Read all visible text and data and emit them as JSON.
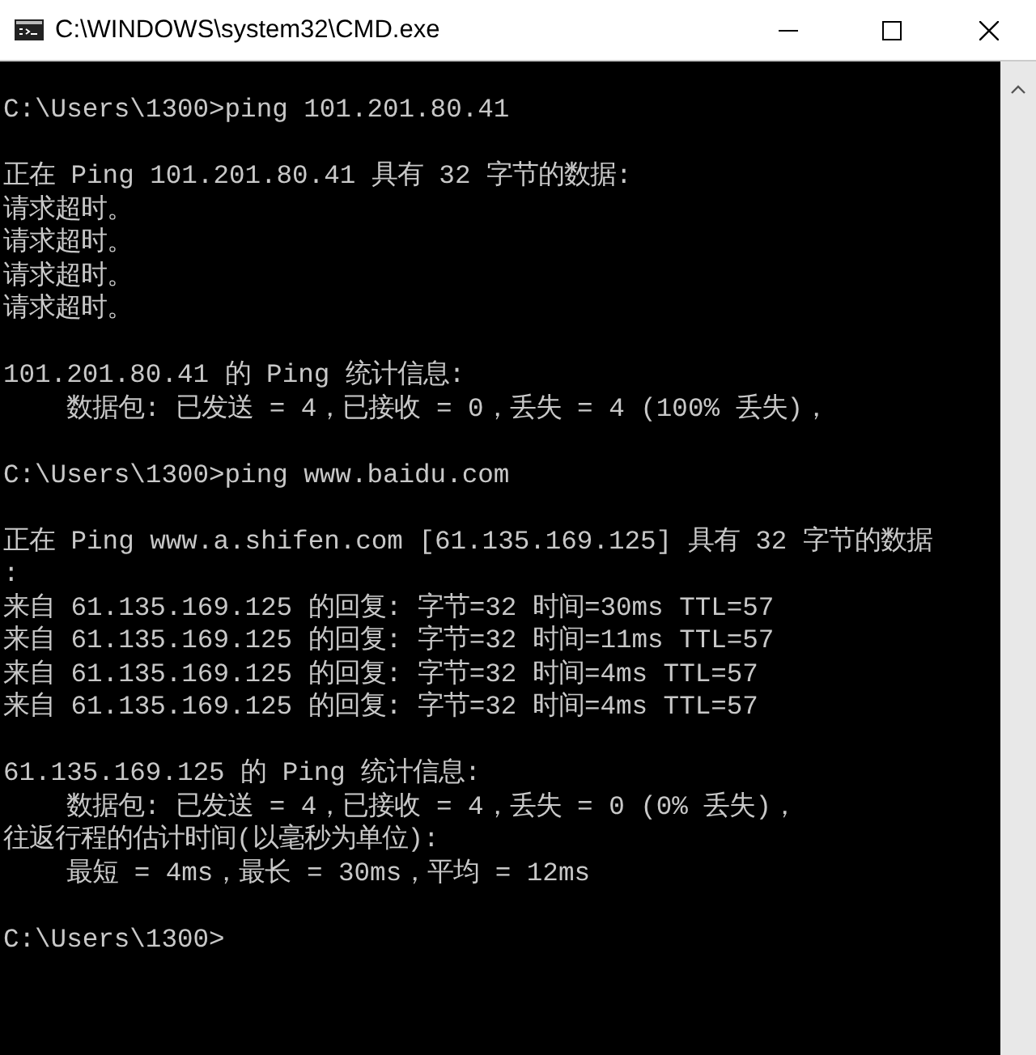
{
  "window": {
    "title": "C:\\WINDOWS\\system32\\CMD.exe"
  },
  "console": {
    "blocks": [
      [
        "C:\\Users\\1300>ping 101.201.80.41"
      ],
      [
        "正在 Ping 101.201.80.41 具有 32 字节的数据:",
        "请求超时。",
        "请求超时。",
        "请求超时。",
        "请求超时。"
      ],
      [
        "101.201.80.41 的 Ping 统计信息:",
        "    数据包: 已发送 = 4，已接收 = 0，丢失 = 4 (100% 丢失)，"
      ],
      [
        "C:\\Users\\1300>ping www.baidu.com"
      ],
      [
        "正在 Ping www.a.shifen.com [61.135.169.125] 具有 32 字节的数据",
        ":",
        "来自 61.135.169.125 的回复: 字节=32 时间=30ms TTL=57",
        "来自 61.135.169.125 的回复: 字节=32 时间=11ms TTL=57",
        "来自 61.135.169.125 的回复: 字节=32 时间=4ms TTL=57",
        "来自 61.135.169.125 的回复: 字节=32 时间=4ms TTL=57"
      ],
      [
        "61.135.169.125 的 Ping 统计信息:",
        "    数据包: 已发送 = 4，已接收 = 4，丢失 = 0 (0% 丢失)，",
        "往返行程的估计时间(以毫秒为单位):",
        "    最短 = 4ms，最长 = 30ms，平均 = 12ms"
      ],
      [
        "C:\\Users\\1300>"
      ]
    ]
  }
}
